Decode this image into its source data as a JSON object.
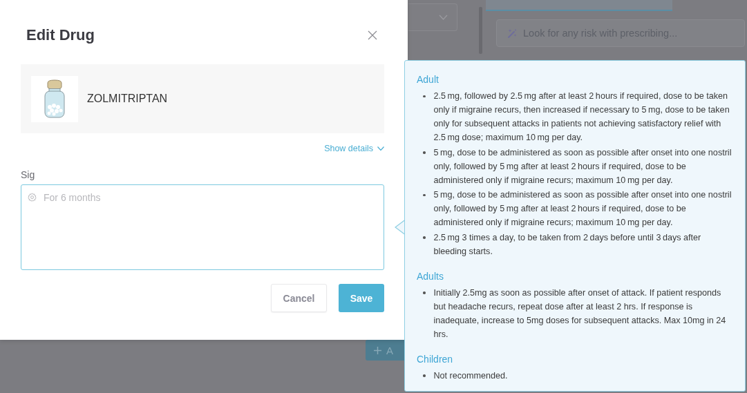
{
  "background": {
    "tabs": [
      {
        "selected": true
      }
    ],
    "search": {
      "placeholder": "Look for any risk with prescribing..."
    },
    "add_button": {
      "label": "A"
    }
  },
  "dialog": {
    "title": "Edit Drug",
    "drug": {
      "name": "ZOLMITRIPTAN"
    },
    "details_link": "Show details",
    "sig": {
      "label": "Sig",
      "placeholder": "For 6 months"
    },
    "buttons": [
      {
        "label": "Cancel",
        "kind": "secondary"
      },
      {
        "label": "Save",
        "kind": "primary"
      }
    ]
  },
  "dosage_popover": {
    "sections": [
      {
        "heading": "Adult",
        "items": [
          "2.5 mg, followed by 2.5 mg after at least 2 hours if required, dose to be taken only if migraine recurs, then increased if necessary to 5 mg, dose to be taken only for subsequent attacks in patients not achieving satisfactory relief with 2.5 mg dose; maximum 10 mg per day.",
          "5 mg, dose to be administered as soon as possible after onset into one nostril only, followed by 5 mg after at least 2 hours if required, dose to be administered only if migraine recurs; maximum 10 mg per day.",
          "5 mg, dose to be administered as soon as possible after onset into one nostril only, followed by 5 mg after at least 2 hours if required, dose to be administered only if migraine recurs; maximum 10 mg per day.",
          "2.5 mg 3 times a day, to be taken from 2 days before until 3 days after bleeding starts."
        ]
      },
      {
        "heading": "Adults",
        "items": [
          "Initially 2.5mg as soon as possible after onset of attack. If patient responds but headache recurs, repeat dose after at least 2 hrs. If response is inadequate, increase to 5mg doses for subsequent attacks. Max 10mg in 24 hrs."
        ]
      },
      {
        "heading": "Children",
        "items": [
          "Not recommended."
        ]
      }
    ]
  }
}
